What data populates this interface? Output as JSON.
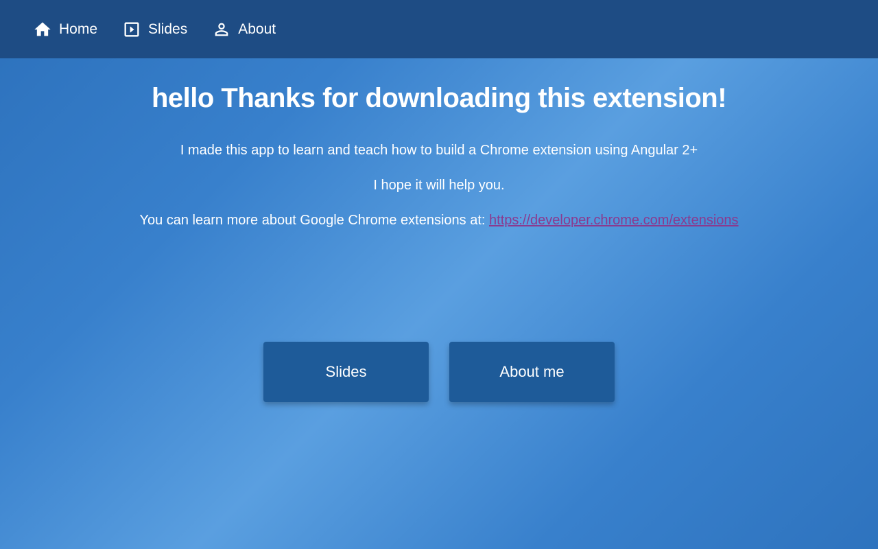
{
  "navbar": {
    "items": [
      {
        "label": "Home"
      },
      {
        "label": "Slides"
      },
      {
        "label": "About"
      }
    ]
  },
  "main": {
    "title": "hello Thanks for downloading this extension!",
    "description1": "I made this app to learn and teach how to build a Chrome extension using Angular 2+",
    "description2": "I hope it will help you.",
    "linkPrefix": "You can learn more about Google Chrome extensions at: ",
    "linkText": "https://developer.chrome.com/extensions",
    "linkUrl": "https://developer.chrome.com/extensions"
  },
  "buttons": {
    "slides": "Slides",
    "about": "About me"
  }
}
